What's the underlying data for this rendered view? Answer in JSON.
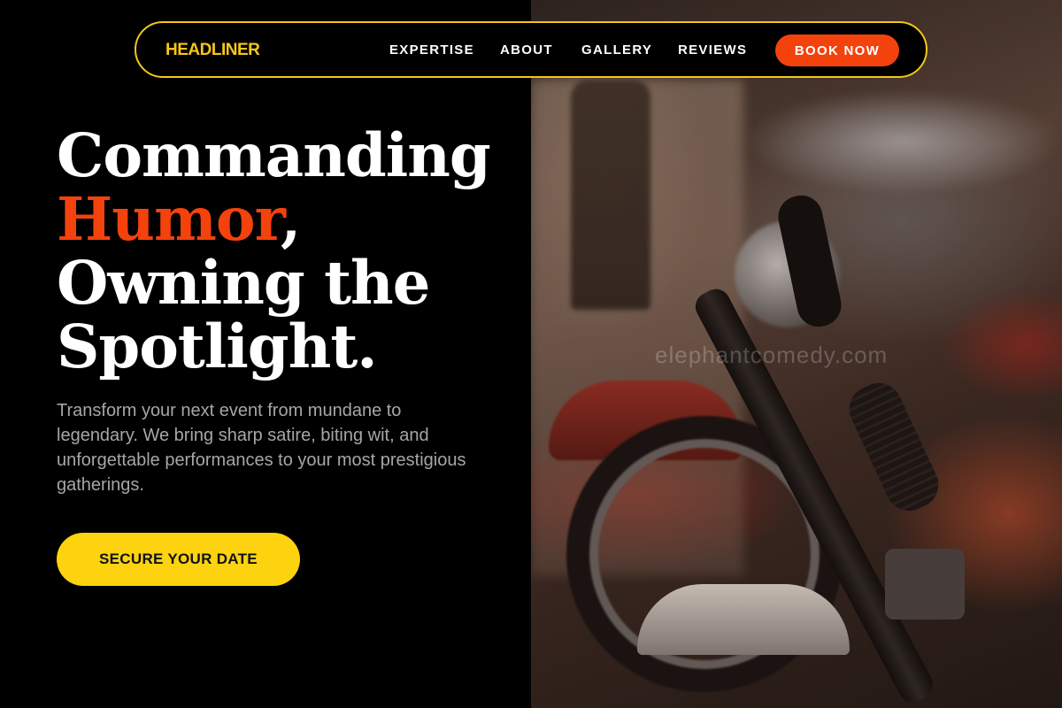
{
  "nav": {
    "logo": "HEADLINER",
    "links": [
      "EXPERTISE",
      "ABOUT",
      "GALLERY",
      "REVIEWS"
    ],
    "cta_label": "BOOK NOW"
  },
  "hero": {
    "headline_line1": "Commanding",
    "headline_accent": "Humor",
    "headline_comma": ",",
    "headline_line3": "Owning the",
    "headline_line4": "Spotlight.",
    "subtitle": "Transform your next event from mundane to legendary. We bring sharp satire, biting wit, and unforgettable performances to your most prestigious gatherings.",
    "cta_label": "SECURE YOUR DATE"
  },
  "photo": {
    "watermark": "elephantcomedy.com"
  },
  "colors": {
    "background": "#000000",
    "logo_yellow": "#f7c51a",
    "accent_orange": "#f4420d",
    "cta_yellow": "#fdd20f",
    "subtitle_gray": "#a6a6a6"
  }
}
